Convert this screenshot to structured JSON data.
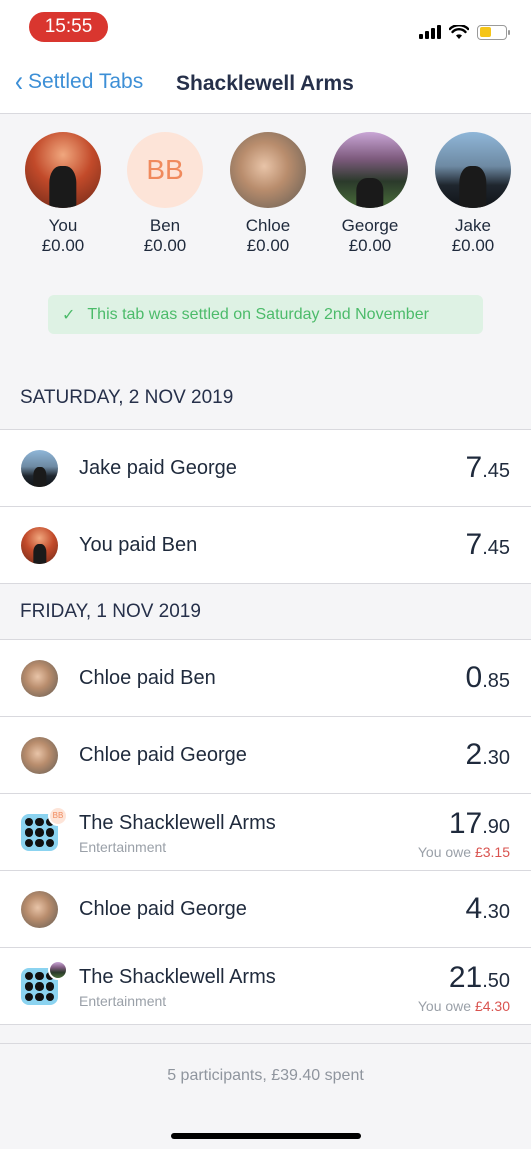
{
  "status_bar": {
    "time": "15:55"
  },
  "nav": {
    "back_label": "Settled Tabs",
    "title": "Shacklewell Arms"
  },
  "participants": [
    {
      "name": "You",
      "balance": "£0.00",
      "avatar": "photo"
    },
    {
      "name": "Ben",
      "balance": "£0.00",
      "avatar": "initials",
      "initials": "BB"
    },
    {
      "name": "Chloe",
      "balance": "£0.00",
      "avatar": "photo"
    },
    {
      "name": "George",
      "balance": "£0.00",
      "avatar": "photo"
    },
    {
      "name": "Jake",
      "balance": "£0.00",
      "avatar": "photo"
    }
  ],
  "settled_notice": "This tab was settled on Saturday 2nd November",
  "sections": [
    {
      "date": "SATURDAY, 2 NOV 2019",
      "rows": [
        {
          "title": "Jake paid George",
          "whole": "7",
          "cents": ".45"
        },
        {
          "title": "You paid Ben",
          "whole": "7",
          "cents": ".45"
        }
      ]
    },
    {
      "date": "FRIDAY, 1 NOV 2019",
      "rows": [
        {
          "title": "Chloe paid Ben",
          "whole": "0",
          "cents": ".85"
        },
        {
          "title": "Chloe paid George",
          "whole": "2",
          "cents": ".30"
        },
        {
          "title": "The Shacklewell Arms",
          "subtitle": "Entertainment",
          "whole": "17",
          "cents": ".90",
          "owe_label": "You owe",
          "owe_amount": "£3.15"
        },
        {
          "title": "Chloe paid George",
          "whole": "4",
          "cents": ".30"
        },
        {
          "title": "The Shacklewell Arms",
          "subtitle": "Entertainment",
          "whole": "21",
          "cents": ".50",
          "owe_label": "You owe",
          "owe_amount": "£4.30"
        }
      ]
    }
  ],
  "footer": {
    "summary": "5 participants, £39.40 spent"
  },
  "colors": {
    "accent": "#3d8fd6",
    "settled_green": "#4cbb6a",
    "owe_red": "#d9534f",
    "time_pill": "#d9362f"
  }
}
